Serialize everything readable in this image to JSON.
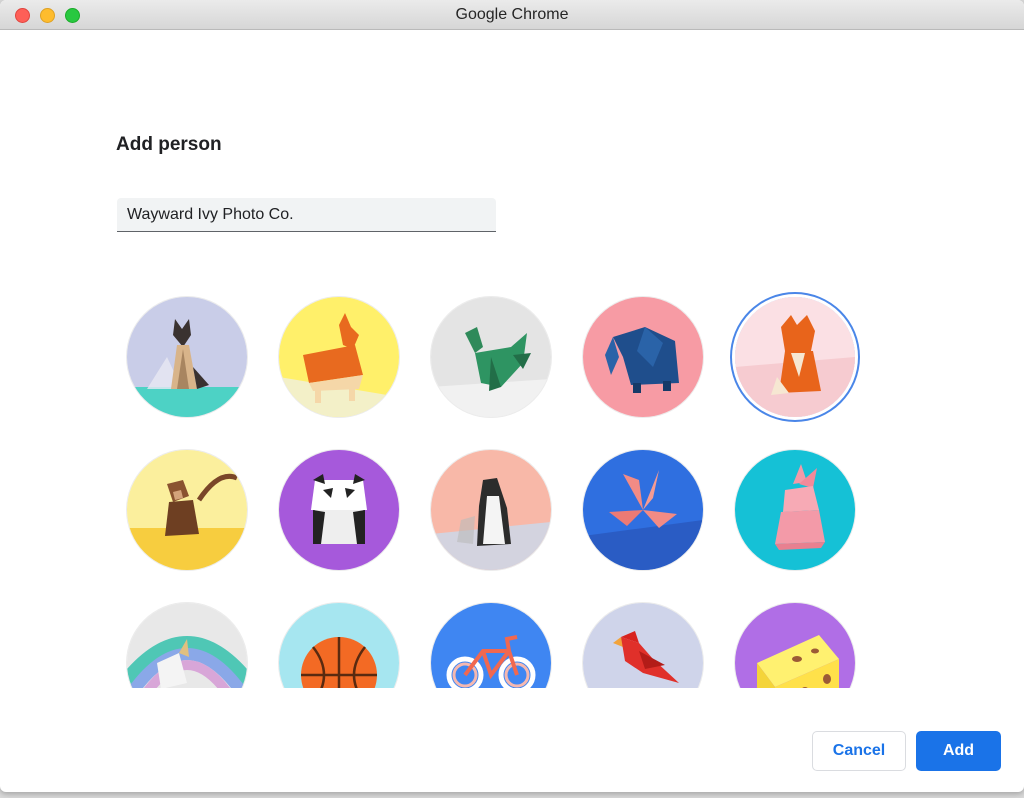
{
  "window": {
    "title": "Google Chrome"
  },
  "dialog": {
    "heading": "Add person",
    "name_input": {
      "value": "Wayward Ivy Photo Co."
    },
    "avatars": [
      {
        "name": "cat"
      },
      {
        "name": "corgi"
      },
      {
        "name": "dragon"
      },
      {
        "name": "elephant"
      },
      {
        "name": "fox",
        "selected": true
      },
      {
        "name": "monkey"
      },
      {
        "name": "panda"
      },
      {
        "name": "penguin"
      },
      {
        "name": "butterfly"
      },
      {
        "name": "rabbit"
      },
      {
        "name": "unicorn"
      },
      {
        "name": "basketball"
      },
      {
        "name": "bicycle"
      },
      {
        "name": "bird"
      },
      {
        "name": "cheese"
      }
    ],
    "buttons": {
      "cancel": "Cancel",
      "add": "Add"
    }
  },
  "colors": {
    "accent": "#1a73e8",
    "selection_ring": "#4a86e8"
  }
}
